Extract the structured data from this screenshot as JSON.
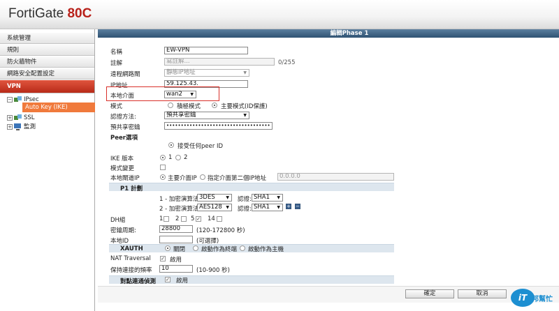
{
  "app": {
    "brand": "FortiGate",
    "model": "80C"
  },
  "sidebar": {
    "items": [
      {
        "label": "系統管理"
      },
      {
        "label": "規則"
      },
      {
        "label": "防火牆物件"
      },
      {
        "label": "網路安全配置設定"
      },
      {
        "label": "VPN"
      }
    ],
    "tree": {
      "ipsec": "IPsec",
      "auto_key": "Auto Key (IKE)",
      "ssl": "SSL",
      "monitor": "監測"
    }
  },
  "form": {
    "title": "編輯Phase 1",
    "name_label": "名稱",
    "name_value": "EW-VPN",
    "comment_label": "註解",
    "comment_placeholder": "寫註解...",
    "comment_count": "0/255",
    "remote_gw_label": "遠程網路閘",
    "remote_gw_value": "靜態IP地址",
    "ip_label": "IP地址",
    "ip_value": "59.125.43.",
    "local_if_label": "本地介面",
    "local_if_value": "wan2",
    "mode_label": "模式",
    "mode_aggressive": "積極模式",
    "mode_main": "主要模式(ID保護)",
    "auth_label": "認證方法:",
    "auth_value": "預共享密鑰",
    "psk_label": "預共享密鑰",
    "psk_value": "••••••••••••••••••••••••••••••••••••",
    "peer_heading": "Peer選項",
    "peer_option": "接受任何peer ID",
    "ike_label": "IKE 版本",
    "ike_v1": "1",
    "ike_v2": "2",
    "mode_cfg_label": "模式變更",
    "local_gw_label": "本地閘道IP",
    "local_gw_main": "主要介面IP",
    "local_gw_other": "指定介面第二個IP地址",
    "local_gw_ip": "0.0.0.0",
    "p1_heading": "P1 計劃",
    "enc1_label": "1 - 加密演算法:",
    "enc1_value": "3DES",
    "auth1_label": "認證:",
    "auth1_value": "SHA1",
    "enc2_label": "2 - 加密演算法:",
    "enc2_value": "AES128",
    "auth2_label": "認證:",
    "auth2_value": "SHA1",
    "plus_icon": "+",
    "minus_icon": "−",
    "dh_label": "DH組",
    "dh_opts": [
      "1",
      "2",
      "5",
      "14"
    ],
    "keylife_label": "密鑰周期:",
    "keylife_value": "28800",
    "keylife_hint": "(120-172800 秒)",
    "localid_label": "本地ID",
    "localid_hint": "(可選擇)",
    "xauth_heading": "XAUTH",
    "xauth_off": "關閉",
    "xauth_client": "啟動作為終端",
    "xauth_server": "啟動作為主機",
    "nat_label": "NAT Traversal",
    "nat_value": "啟用",
    "keepalive_label": "保持連接的頻率",
    "keepalive_value": "10",
    "keepalive_hint": "(10-900 秒)",
    "dpd_heading": "對點連通偵測",
    "dpd_value": "啟用"
  },
  "buttons": {
    "ok": "確定",
    "cancel": "取消"
  },
  "watermark": {
    "it": "iT",
    "text": "邦幫忙"
  }
}
